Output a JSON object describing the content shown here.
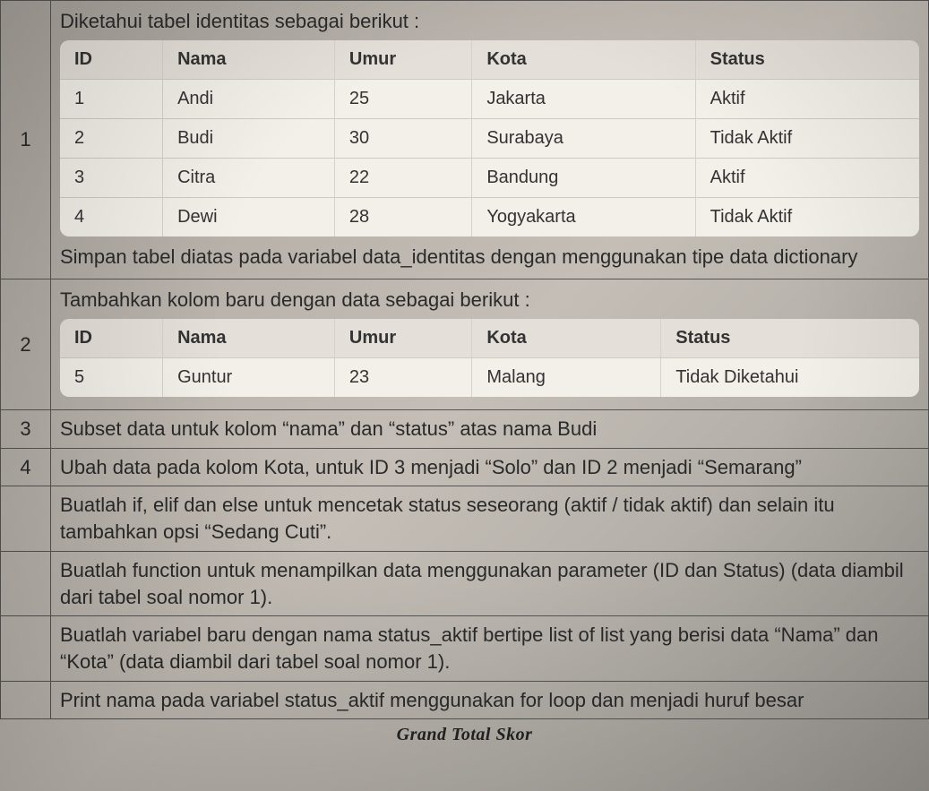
{
  "rows": {
    "r1": {
      "num": "1",
      "intro": "Diketahui tabel identitas sebagai berikut :",
      "table": {
        "headers": [
          "ID",
          "Nama",
          "Umur",
          "Kota",
          "Status"
        ],
        "rows": [
          [
            "1",
            "Andi",
            "25",
            "Jakarta",
            "Aktif"
          ],
          [
            "2",
            "Budi",
            "30",
            "Surabaya",
            "Tidak Aktif"
          ],
          [
            "3",
            "Citra",
            "22",
            "Bandung",
            "Aktif"
          ],
          [
            "4",
            "Dewi",
            "28",
            "Yogyakarta",
            "Tidak Aktif"
          ]
        ]
      },
      "outro": "Simpan tabel diatas pada variabel data_identitas dengan menggunakan tipe data dictionary"
    },
    "r2": {
      "num": "2",
      "intro": "Tambahkan kolom baru dengan data sebagai berikut :",
      "table": {
        "headers": [
          "ID",
          "Nama",
          "Umur",
          "Kota",
          "Status"
        ],
        "rows": [
          [
            "5",
            "Guntur",
            "23",
            "Malang",
            "Tidak Diketahui"
          ]
        ]
      }
    },
    "r3": {
      "num": "3",
      "text": "Subset data untuk kolom “nama” dan “status” atas nama Budi"
    },
    "r4": {
      "num": "4",
      "text": "Ubah data pada kolom Kota, untuk ID 3 menjadi “Solo” dan ID 2 menjadi “Semarang”"
    },
    "r5": {
      "text": "Buatlah if, elif dan else untuk mencetak status seseorang (aktif / tidak aktif) dan selain itu tambahkan opsi “Sedang Cuti”."
    },
    "r6": {
      "text": "Buatlah function untuk menampilkan data menggunakan parameter (ID dan Status) (data diambil dari tabel soal nomor 1)."
    },
    "r7": {
      "text": "Buatlah variabel baru dengan nama status_aktif bertipe list of list yang berisi data “Nama” dan “Kota” (data diambil dari tabel soal nomor 1)."
    },
    "r8": {
      "text": "Print nama pada variabel status_aktif menggunakan for loop dan menjadi huruf besar"
    }
  },
  "footer": "Grand Total Skor"
}
